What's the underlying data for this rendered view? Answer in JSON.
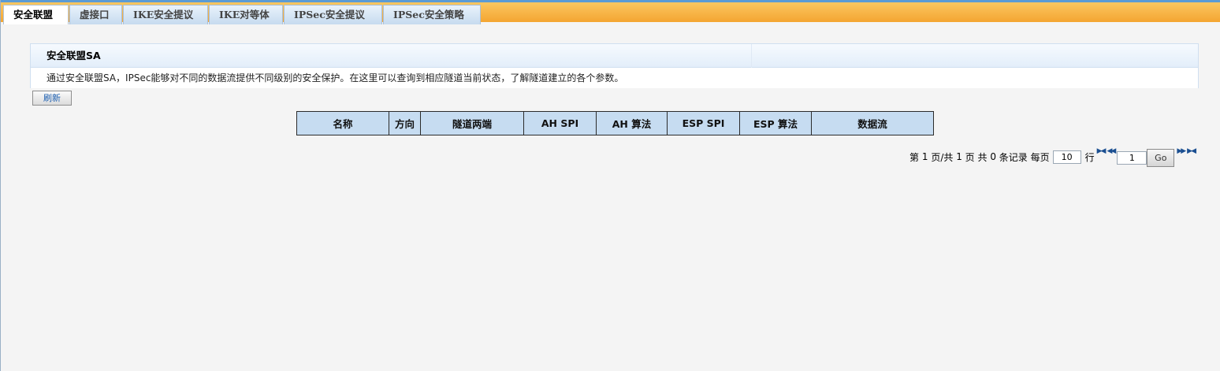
{
  "tabs": [
    {
      "label": "安全联盟",
      "active": true
    },
    {
      "label": "虚接口",
      "active": false
    },
    {
      "label": "IKE安全提议",
      "active": false
    },
    {
      "label": "IKE对等体",
      "active": false
    },
    {
      "label": "IPSec安全提议",
      "active": false
    },
    {
      "label": "IPSec安全策略",
      "active": false
    }
  ],
  "panel": {
    "title": "安全联盟SA",
    "description": "通过安全联盟SA，IPSec能够对不同的数据流提供不同级别的安全保护。在这里可以查询到相应隧道当前状态，了解隧道建立的各个参数。"
  },
  "refresh_label": "刷新",
  "table": {
    "columns": [
      "名称",
      "方向",
      "隧道两端",
      "AH SPI",
      "AH 算法",
      "ESP SPI",
      "ESP 算法",
      "数据流"
    ],
    "rows": []
  },
  "pager": {
    "prefix": "第",
    "current_page": "1",
    "of_label": "页/共",
    "total_pages": "1",
    "pages_label": "页 共",
    "record_count": "0",
    "records_label": "条记录 每页",
    "per_page": "10",
    "rows_label": "行",
    "goto_page": "1",
    "go_label": "Go"
  },
  "colors": {
    "tabbar": "#f4a531",
    "tab_bg": "#c6dbef",
    "table_header": "#c6dcf1",
    "page_bg": "#f4f4f4"
  }
}
